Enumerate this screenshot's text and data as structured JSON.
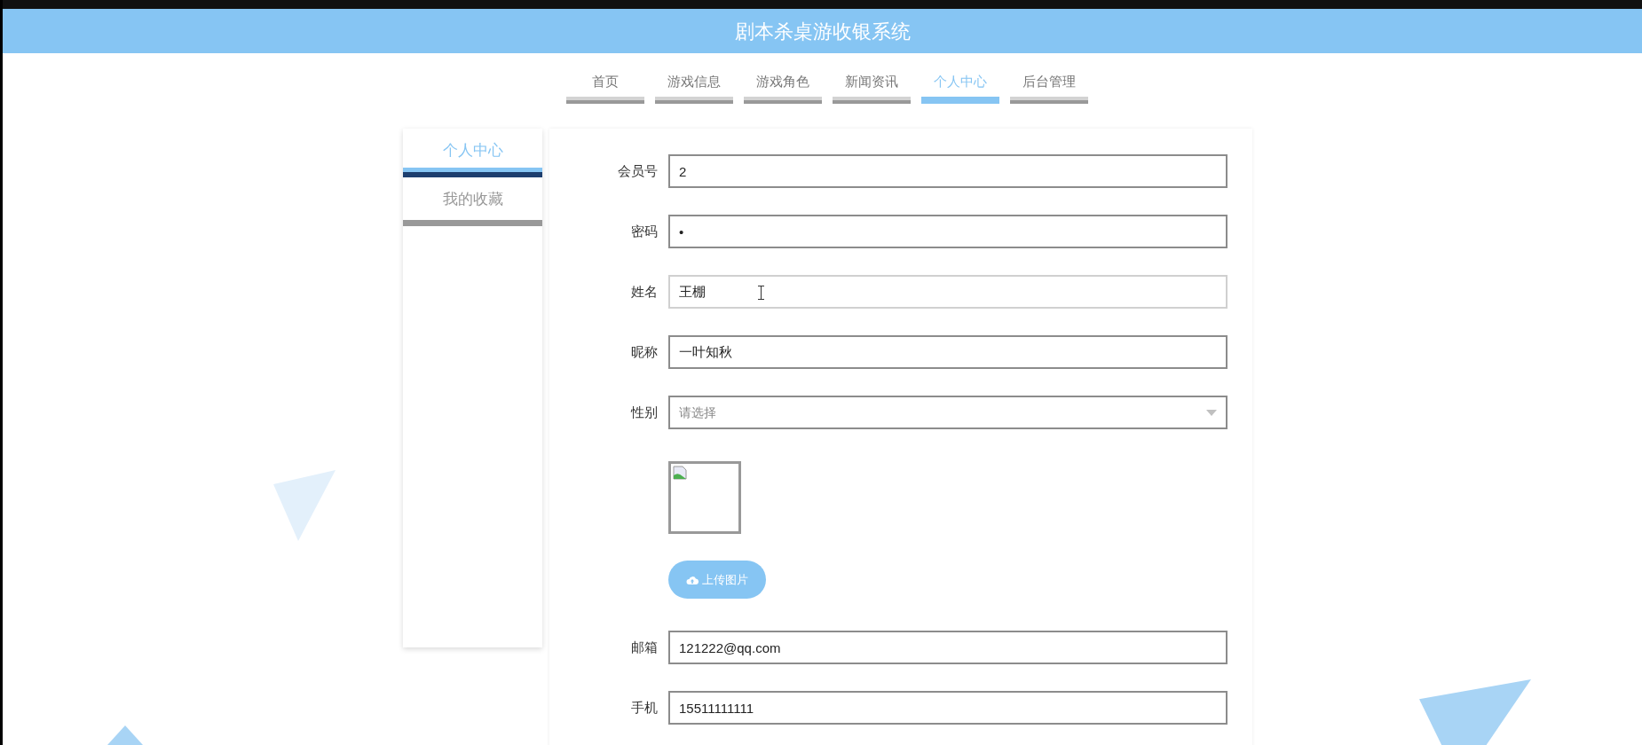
{
  "header": {
    "title": "剧本杀桌游收银系统"
  },
  "nav": [
    {
      "label": "首页",
      "selected": false
    },
    {
      "label": "游戏信息",
      "selected": false
    },
    {
      "label": "游戏角色",
      "selected": false
    },
    {
      "label": "新闻资讯",
      "selected": false
    },
    {
      "label": "个人中心",
      "selected": true
    },
    {
      "label": "后台管理",
      "selected": false
    }
  ],
  "sidebar": {
    "items": [
      {
        "label": "个人中心",
        "selected": true
      },
      {
        "label": "我的收藏",
        "selected": false
      }
    ]
  },
  "form": {
    "fields": [
      {
        "kind": "text",
        "label": "会员号",
        "value": "2",
        "focused": false
      },
      {
        "kind": "text",
        "label": "密码",
        "value": "•",
        "focused": false
      },
      {
        "kind": "text",
        "label": "姓名",
        "value": "王棚",
        "focused": true
      },
      {
        "kind": "text",
        "label": "昵称",
        "value": "一叶知秋",
        "focused": false
      },
      {
        "kind": "select",
        "label": "性别",
        "placeholder": "请选择",
        "focused": false
      },
      {
        "kind": "image",
        "upload_label": "上传图片"
      },
      {
        "kind": "text",
        "label": "邮箱",
        "value": "121222@qq.com",
        "focused": false
      },
      {
        "kind": "text",
        "label": "手机",
        "value": "15511111111",
        "focused": false
      }
    ]
  }
}
